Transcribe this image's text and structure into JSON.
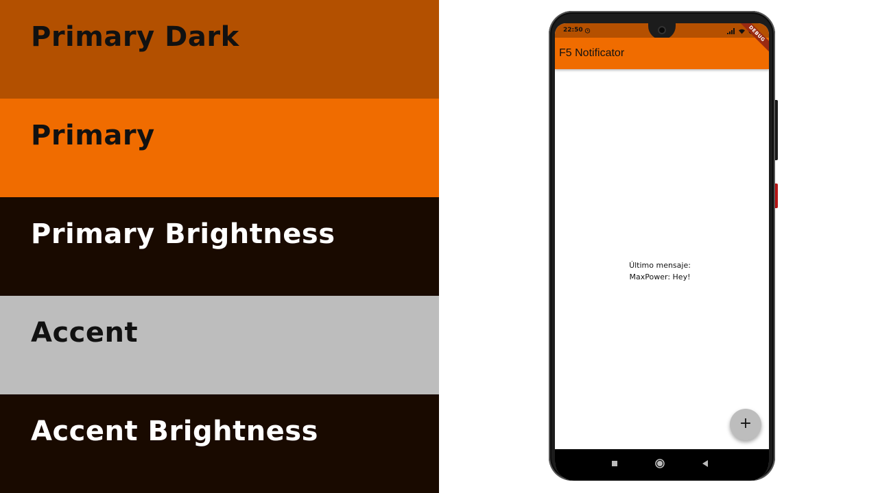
{
  "swatches": [
    {
      "label": "Primary Dark",
      "bg": "#b35000",
      "fg": "#111111"
    },
    {
      "label": "Primary",
      "bg": "#f06c00",
      "fg": "#111111"
    },
    {
      "label": "Primary Brightness",
      "bg": "#190a00",
      "fg": "#ffffff"
    },
    {
      "label": "Accent",
      "bg": "#bdbdbd",
      "fg": "#111111"
    },
    {
      "label": "Accent Brightness",
      "bg": "#190a00",
      "fg": "#ffffff"
    }
  ],
  "phone": {
    "status_bar": {
      "time": "22:50"
    },
    "debug_banner": "DEBUG",
    "app_bar": {
      "title": "F5 Notificator"
    },
    "body": {
      "line1": "Último mensaje:",
      "line2": "MaxPower: Hey!"
    },
    "fab_label": "+",
    "nav_bar": {
      "icons": [
        "square-recents-icon",
        "circle-home-icon",
        "triangle-back-icon"
      ]
    }
  }
}
